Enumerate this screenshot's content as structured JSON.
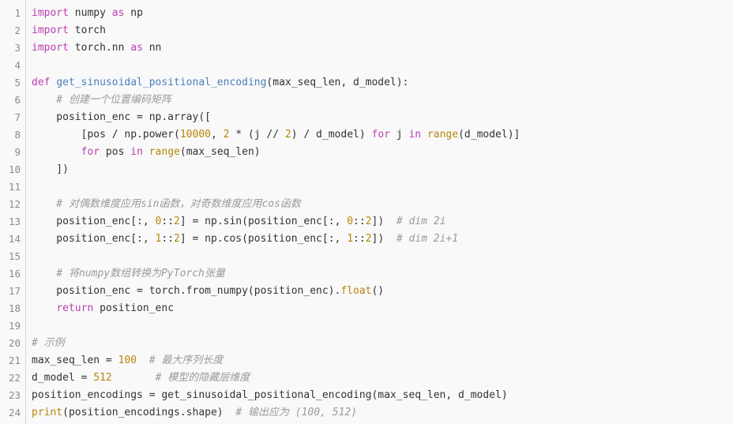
{
  "editor": {
    "language": "python",
    "total_lines": 24,
    "background_color": "#f9f9f9",
    "gutter_divider_color": "#d8d8d8",
    "line_number_color": "#8a8a8a",
    "colors": {
      "keyword": "#bb3db0",
      "function_name": "#4a7ebb",
      "builtin": "#b8860b",
      "number": "#b8860b",
      "comment": "#9a9a9a",
      "plain": "#333333"
    }
  },
  "line_numbers": [
    "1",
    "2",
    "3",
    "4",
    "5",
    "6",
    "7",
    "8",
    "9",
    "10",
    "11",
    "12",
    "13",
    "14",
    "15",
    "16",
    "17",
    "18",
    "19",
    "20",
    "21",
    "22",
    "23",
    "24"
  ],
  "lines": [
    {
      "n": "1",
      "tokens": [
        {
          "t": "import",
          "c": "kw"
        },
        {
          "t": " numpy ",
          "c": "plain"
        },
        {
          "t": "as",
          "c": "kw"
        },
        {
          "t": " np",
          "c": "plain"
        }
      ]
    },
    {
      "n": "2",
      "tokens": [
        {
          "t": "import",
          "c": "kw"
        },
        {
          "t": " torch",
          "c": "plain"
        }
      ]
    },
    {
      "n": "3",
      "tokens": [
        {
          "t": "import",
          "c": "kw"
        },
        {
          "t": " torch.nn ",
          "c": "plain"
        },
        {
          "t": "as",
          "c": "kw"
        },
        {
          "t": " nn",
          "c": "plain"
        }
      ]
    },
    {
      "n": "4",
      "tokens": []
    },
    {
      "n": "5",
      "tokens": [
        {
          "t": "def",
          "c": "kw"
        },
        {
          "t": " ",
          "c": "plain"
        },
        {
          "t": "get_sinusoidal_positional_encoding",
          "c": "fn"
        },
        {
          "t": "(max_seq_len, d_model):",
          "c": "plain"
        }
      ]
    },
    {
      "n": "6",
      "tokens": [
        {
          "t": "    # 创建一个位置编码矩阵",
          "c": "comment"
        }
      ]
    },
    {
      "n": "7",
      "tokens": [
        {
          "t": "    position_enc = np.array([",
          "c": "plain"
        }
      ]
    },
    {
      "n": "8",
      "tokens": [
        {
          "t": "        [pos / np.power(",
          "c": "plain"
        },
        {
          "t": "10000",
          "c": "num"
        },
        {
          "t": ", ",
          "c": "plain"
        },
        {
          "t": "2",
          "c": "num"
        },
        {
          "t": " * (j // ",
          "c": "plain"
        },
        {
          "t": "2",
          "c": "num"
        },
        {
          "t": ") / d_model) ",
          "c": "plain"
        },
        {
          "t": "for",
          "c": "kw"
        },
        {
          "t": " j ",
          "c": "plain"
        },
        {
          "t": "in",
          "c": "kw"
        },
        {
          "t": " ",
          "c": "plain"
        },
        {
          "t": "range",
          "c": "builtin"
        },
        {
          "t": "(d_model)]",
          "c": "plain"
        }
      ]
    },
    {
      "n": "9",
      "tokens": [
        {
          "t": "        ",
          "c": "plain"
        },
        {
          "t": "for",
          "c": "kw"
        },
        {
          "t": " pos ",
          "c": "plain"
        },
        {
          "t": "in",
          "c": "kw"
        },
        {
          "t": " ",
          "c": "plain"
        },
        {
          "t": "range",
          "c": "builtin"
        },
        {
          "t": "(max_seq_len)",
          "c": "plain"
        }
      ]
    },
    {
      "n": "10",
      "tokens": [
        {
          "t": "    ])",
          "c": "plain"
        }
      ]
    },
    {
      "n": "11",
      "tokens": []
    },
    {
      "n": "12",
      "tokens": [
        {
          "t": "    # 对偶数维度应用sin函数，对奇数维度应用cos函数",
          "c": "comment"
        }
      ]
    },
    {
      "n": "13",
      "tokens": [
        {
          "t": "    position_enc[:, ",
          "c": "plain"
        },
        {
          "t": "0",
          "c": "num"
        },
        {
          "t": "::",
          "c": "plain"
        },
        {
          "t": "2",
          "c": "num"
        },
        {
          "t": "] = np.sin(position_enc[:, ",
          "c": "plain"
        },
        {
          "t": "0",
          "c": "num"
        },
        {
          "t": "::",
          "c": "plain"
        },
        {
          "t": "2",
          "c": "num"
        },
        {
          "t": "])  ",
          "c": "plain"
        },
        {
          "t": "# dim 2i",
          "c": "comment"
        }
      ]
    },
    {
      "n": "14",
      "tokens": [
        {
          "t": "    position_enc[:, ",
          "c": "plain"
        },
        {
          "t": "1",
          "c": "num"
        },
        {
          "t": "::",
          "c": "plain"
        },
        {
          "t": "2",
          "c": "num"
        },
        {
          "t": "] = np.cos(position_enc[:, ",
          "c": "plain"
        },
        {
          "t": "1",
          "c": "num"
        },
        {
          "t": "::",
          "c": "plain"
        },
        {
          "t": "2",
          "c": "num"
        },
        {
          "t": "])  ",
          "c": "plain"
        },
        {
          "t": "# dim 2i+1",
          "c": "comment"
        }
      ]
    },
    {
      "n": "15",
      "tokens": []
    },
    {
      "n": "16",
      "tokens": [
        {
          "t": "    # 将numpy数组转换为PyTorch张量",
          "c": "comment"
        }
      ]
    },
    {
      "n": "17",
      "tokens": [
        {
          "t": "    position_enc = torch.from_numpy(position_enc).",
          "c": "plain"
        },
        {
          "t": "float",
          "c": "builtin"
        },
        {
          "t": "()",
          "c": "plain"
        }
      ]
    },
    {
      "n": "18",
      "tokens": [
        {
          "t": "    ",
          "c": "plain"
        },
        {
          "t": "return",
          "c": "kw"
        },
        {
          "t": " position_enc",
          "c": "plain"
        }
      ]
    },
    {
      "n": "19",
      "tokens": []
    },
    {
      "n": "20",
      "tokens": [
        {
          "t": "# 示例",
          "c": "comment"
        }
      ]
    },
    {
      "n": "21",
      "tokens": [
        {
          "t": "max_seq_len = ",
          "c": "plain"
        },
        {
          "t": "100",
          "c": "num"
        },
        {
          "t": "  ",
          "c": "plain"
        },
        {
          "t": "# 最大序列长度",
          "c": "comment"
        }
      ]
    },
    {
      "n": "22",
      "tokens": [
        {
          "t": "d_model = ",
          "c": "plain"
        },
        {
          "t": "512",
          "c": "num"
        },
        {
          "t": "       ",
          "c": "plain"
        },
        {
          "t": "# 模型的隐藏层维度",
          "c": "comment"
        }
      ]
    },
    {
      "n": "23",
      "tokens": [
        {
          "t": "position_encodings = get_sinusoidal_positional_encoding(max_seq_len, d_model)",
          "c": "plain"
        }
      ]
    },
    {
      "n": "24",
      "tokens": [
        {
          "t": "print",
          "c": "builtin"
        },
        {
          "t": "(position_encodings.shape)  ",
          "c": "plain"
        },
        {
          "t": "# 输出应为 (100, 512)",
          "c": "comment"
        }
      ]
    }
  ]
}
